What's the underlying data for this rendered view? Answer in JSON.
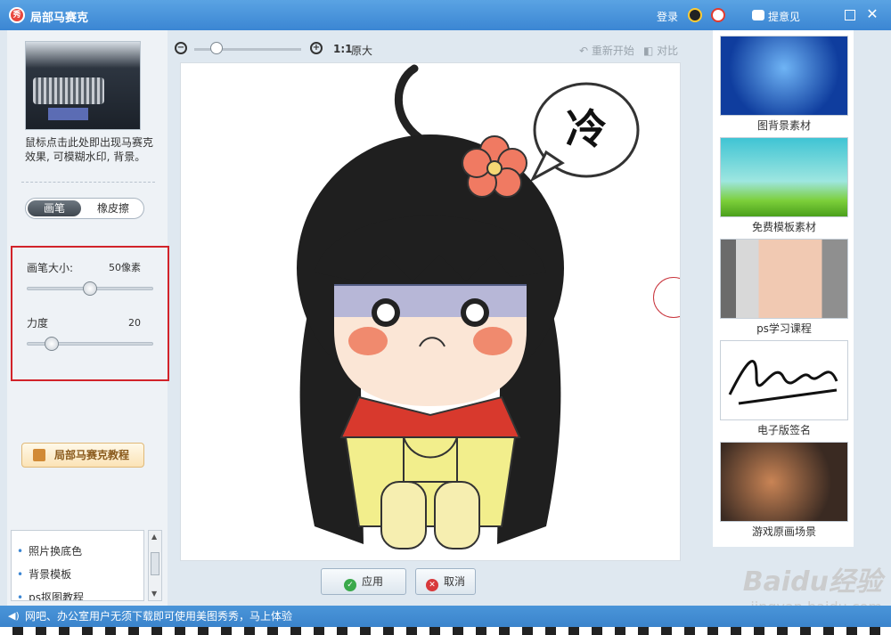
{
  "window": {
    "title": "局部马赛克",
    "login": "登录",
    "feedback": "提意见",
    "logo_text": "秀"
  },
  "left": {
    "description": "鼠标点击此处即出现马赛克效果, 可模糊水印, 背景。",
    "mode_toggle": {
      "active": "画笔",
      "inactive": "橡皮擦"
    },
    "brush_size": {
      "label": "画笔大小:",
      "value": "50像素",
      "level": 0.5
    },
    "strength": {
      "label": "力度",
      "value": "20",
      "level": 0.2
    },
    "tutorial_button": "局部马赛克教程",
    "list_items": [
      "照片换底色",
      "背景模板",
      "ps抠图教程"
    ]
  },
  "toolbar": {
    "zoom_ratio": "1:1",
    "zoom_original": "原大",
    "reset": "重新开始",
    "compare": "对比"
  },
  "canvas": {
    "bubble_text": "冷"
  },
  "actions": {
    "apply": "应用",
    "cancel": "取消"
  },
  "materials": [
    {
      "caption": "图背景素材"
    },
    {
      "caption": "免费模板素材"
    },
    {
      "caption": "ps学习课程"
    },
    {
      "caption": "电子版签名"
    },
    {
      "caption": "游戏原画场景"
    }
  ],
  "status": {
    "text": "网吧、办公室用户无须下载即可使用美图秀秀，马上体验"
  },
  "watermark": {
    "brand": "Baidu经验",
    "url": "jingyan.baidu.com"
  },
  "colors": {
    "titlebar": "#3b86d3",
    "highlight_box": "#d2232a"
  }
}
